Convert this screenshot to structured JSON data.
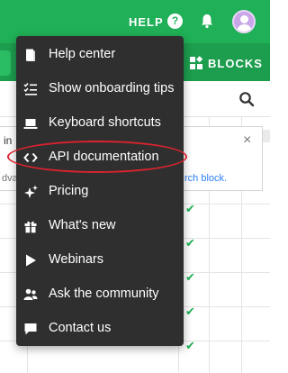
{
  "header": {
    "help_label": "HELP",
    "help_icon": "question-circle-icon",
    "bell_icon": "bell-icon",
    "avatar_icon": "user-avatar-icon",
    "background_color": "#20b057"
  },
  "toolbar": {
    "blocks_label": "BLOCKS",
    "blocks_icon": "blocks-icon"
  },
  "panel": {
    "partial_text": "in",
    "partial_advance": "dva",
    "partial_link": "rch block."
  },
  "menu": {
    "items": [
      {
        "label": "Help center",
        "icon": "book-icon"
      },
      {
        "label": "Show onboarding tips",
        "icon": "checklist-icon"
      },
      {
        "label": "Keyboard shortcuts",
        "icon": "laptop-icon"
      },
      {
        "label": "API documentation",
        "icon": "code-icon"
      },
      {
        "label": "Pricing",
        "icon": "sparkle-icon"
      },
      {
        "label": "What's new",
        "icon": "gift-icon"
      },
      {
        "label": "Webinars",
        "icon": "play-icon"
      },
      {
        "label": "Ask the community",
        "icon": "community-icon"
      },
      {
        "label": "Contact us",
        "icon": "chat-icon"
      }
    ],
    "highlighted_item": "API documentation",
    "highlight_color": "#d9232f"
  }
}
